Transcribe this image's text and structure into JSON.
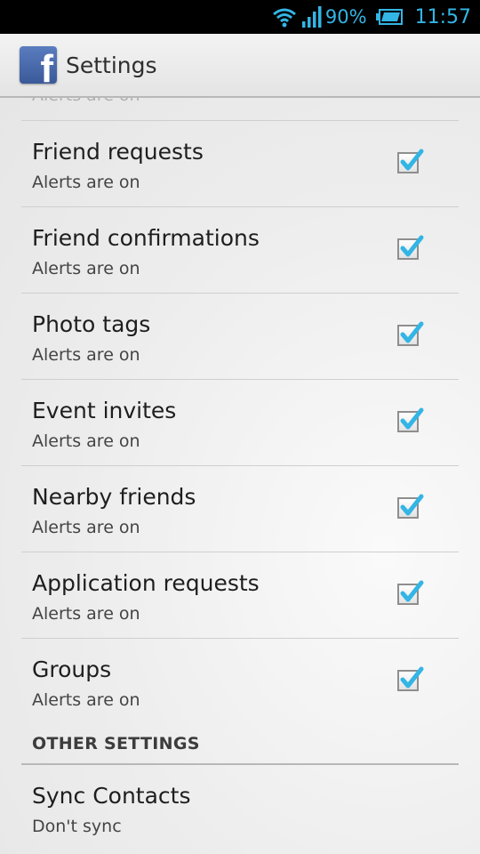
{
  "status_bar": {
    "battery_percent": "90%",
    "time": "11:57",
    "accent_color": "#33b5e5",
    "icons": [
      "wifi-icon",
      "signal-icon",
      "battery-icon"
    ]
  },
  "action_bar": {
    "logo_letter": "f",
    "title": "Settings",
    "brand_color": "#3b5998"
  },
  "list": {
    "partial_summary": "Alerts are on",
    "items": [
      {
        "title": "Friend requests",
        "summary": "Alerts are on",
        "checked": true
      },
      {
        "title": "Friend confirmations",
        "summary": "Alerts are on",
        "checked": true
      },
      {
        "title": "Photo tags",
        "summary": "Alerts are on",
        "checked": true
      },
      {
        "title": "Event invites",
        "summary": "Alerts are on",
        "checked": true
      },
      {
        "title": "Nearby friends",
        "summary": "Alerts are on",
        "checked": true
      },
      {
        "title": "Application requests",
        "summary": "Alerts are on",
        "checked": true
      },
      {
        "title": "Groups",
        "summary": "Alerts are on",
        "checked": true
      }
    ],
    "checkmark_color": "#33b5e5"
  },
  "other_settings": {
    "header": "OTHER SETTINGS",
    "items": [
      {
        "title": "Sync Contacts",
        "summary": "Don't sync"
      }
    ]
  }
}
